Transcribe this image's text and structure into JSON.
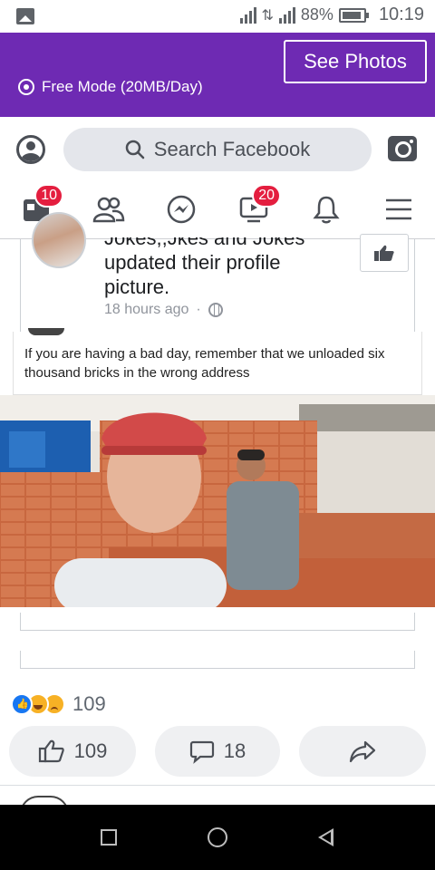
{
  "status_bar": {
    "network_labels": [
      "H",
      "1",
      "H+"
    ],
    "battery": "88%",
    "time": "10:19"
  },
  "free_mode": {
    "label": "Free Mode (20MB/Day)",
    "button": "See Photos"
  },
  "search": {
    "placeholder": "Search Facebook"
  },
  "nav": {
    "home_badge": "10",
    "watch_badge": "20"
  },
  "post": {
    "author_cut": "Jokes,,Jkes and Jokes",
    "text": "updated their profile picture.",
    "time": "18 hours ago",
    "dot": "·"
  },
  "meme": {
    "caption": "If you are having a bad day, remember that we unloaded six thousand bricks in the wrong address"
  },
  "reactions": {
    "count": "109"
  },
  "actions": {
    "like_count": "109",
    "comment_count": "18"
  },
  "colors": {
    "brand_purple": "#6e2ab3",
    "badge_red": "#e41e3f",
    "icon_gray": "#4b4f56",
    "like_blue": "#1877f2"
  }
}
